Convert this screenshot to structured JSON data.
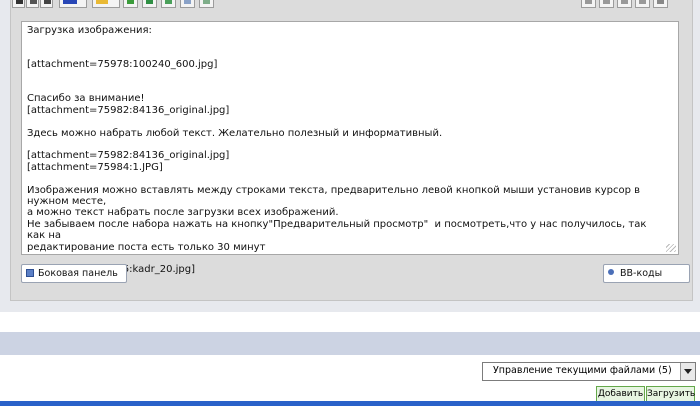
{
  "editor": {
    "lines": [
      "Загрузка изображения:",
      "",
      "",
      "[attachment=75978:100240_600.jpg]",
      "",
      "",
      "Спасибо за внимание!",
      "[attachment=75982:84136_original.jpg]",
      "",
      "Здесь можно набрать любой текст. Желательно полезный и информативный.",
      "",
      "[attachment=75982:84136_original.jpg]",
      "[attachment=75984:1.JPG]",
      "",
      "Изображения можно вставлять между строками текста, предварительно левой кнопкой мыши установив курсор в нужном месте,",
      "а можно текст набрать после загрузки всех изображений.",
      "Не забываем после набора нажать на кнопку\"Предварительный просмотр\"  и посмотреть,что у нас получилось, так как на",
      "редактирование поста есть только 30 минут",
      "",
      "[attachment=75985:kadr_20.jpg]"
    ]
  },
  "buttons": {
    "sidebar_label": "Боковая панель",
    "bbcodes_label": "BB-коды",
    "add_label": "Добавить",
    "upload_label": "Загрузить"
  },
  "files": {
    "selected": "Управление текущими файлами (5)"
  },
  "toolbar_icons": {
    "left": [
      "bold-icon",
      "italic-icon",
      "underline-icon",
      "font-color-icon",
      "emoticon-icon",
      "insert-image-icon",
      "insert-link-icon",
      "insert-email-icon",
      "quote-icon",
      "spoiler-icon"
    ],
    "right": [
      "align-left-icon",
      "align-center-icon",
      "align-right-icon",
      "justify-icon",
      "list-icon"
    ]
  },
  "colors": {
    "accent_green": "#64a84a",
    "bottom_blue": "#2a62c9",
    "band": "#ccd3e3"
  }
}
